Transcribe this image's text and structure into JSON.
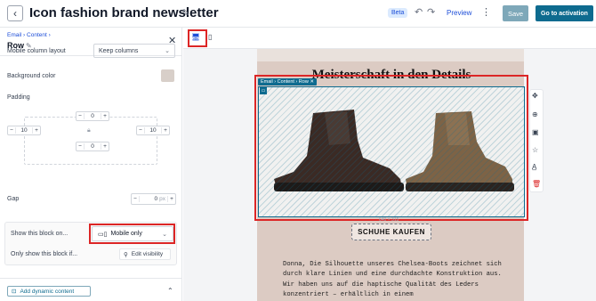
{
  "header": {
    "back_icon": "chevron-left-icon",
    "title": "Icon fashion brand newsletter",
    "beta_badge": "Beta",
    "preview_label": "Preview",
    "save_label": "Save",
    "activation_label": "Go to activation"
  },
  "panel": {
    "breadcrumb": "Email › Content ›",
    "title": "Row",
    "mobile_layout_label": "Mobile column layout",
    "mobile_layout_value": "Keep columns",
    "background_label": "Background color",
    "background_color": "#d8cfc9",
    "padding_label": "Padding",
    "padding": {
      "top": "0",
      "left": "10",
      "right": "10",
      "bottom": "0"
    },
    "gap_label": "Gap",
    "gap_value": "0",
    "gap_unit": "px",
    "show_block_label": "Show this block on...",
    "show_block_value": "Mobile only",
    "only_show_label": "Only show this block if...",
    "edit_visibility_label": "Edit visibility",
    "dynamic_content_label": "Add dynamic content"
  },
  "canvas": {
    "headline": "Meisterschaft in den Details",
    "selection_breadcrumb": "Email › Content › Row",
    "dimension_label": "640 × 315",
    "cta_label": "SCHUHE KAUFEN",
    "body_text": "Donna, Die Silhouette unseres Chelsea-Boots zeichnet sich durch klare Linien und eine durchdachte Konstruktion aus. Wir haben uns auf die haptische Qualität des Leders konzentriert – erhältlich in einem"
  },
  "colors": {
    "accent": "#0e6b8f",
    "highlight": "#dc2626",
    "email_background": "#dccbc3"
  }
}
